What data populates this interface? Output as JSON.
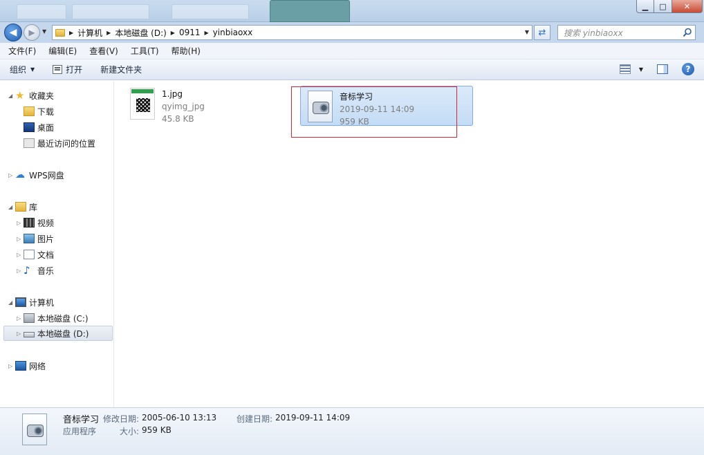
{
  "address": {
    "crumbs": [
      "计算机",
      "本地磁盘 (D:)",
      "0911",
      "yinbiaoxx"
    ],
    "search_placeholder": "搜索 yinbiaoxx"
  },
  "menu": [
    "文件(F)",
    "编辑(E)",
    "查看(V)",
    "工具(T)",
    "帮助(H)"
  ],
  "toolbar": {
    "organize": "组织",
    "open": "打开",
    "new_folder": "新建文件夹"
  },
  "nav": {
    "favorites": "收藏夹",
    "downloads": "下载",
    "desktop": "桌面",
    "recent": "最近访问的位置",
    "wps": "WPS网盘",
    "libraries": "库",
    "videos": "视频",
    "pictures": "图片",
    "documents": "文档",
    "music": "音乐",
    "computer": "计算机",
    "disk_c": "本地磁盘 (C:)",
    "disk_d": "本地磁盘 (D:)",
    "network": "网络"
  },
  "files": [
    {
      "name": "1.jpg",
      "type": "qyimg_jpg",
      "size": "45.8 KB"
    },
    {
      "name": "音标学习",
      "date": "2019-09-11 14:09",
      "size": "959 KB"
    }
  ],
  "details": {
    "name": "音标学习",
    "type": "应用程序",
    "modified_label": "修改日期:",
    "modified": "2005-06-10 13:13",
    "created_label": "创建日期:",
    "created": "2019-09-11 14:09",
    "size_label": "大小:",
    "size": "959 KB"
  },
  "colors": {
    "highlight": "#e0232a",
    "selection": "#cfe3f8",
    "chrome": "#c4d7ed"
  }
}
